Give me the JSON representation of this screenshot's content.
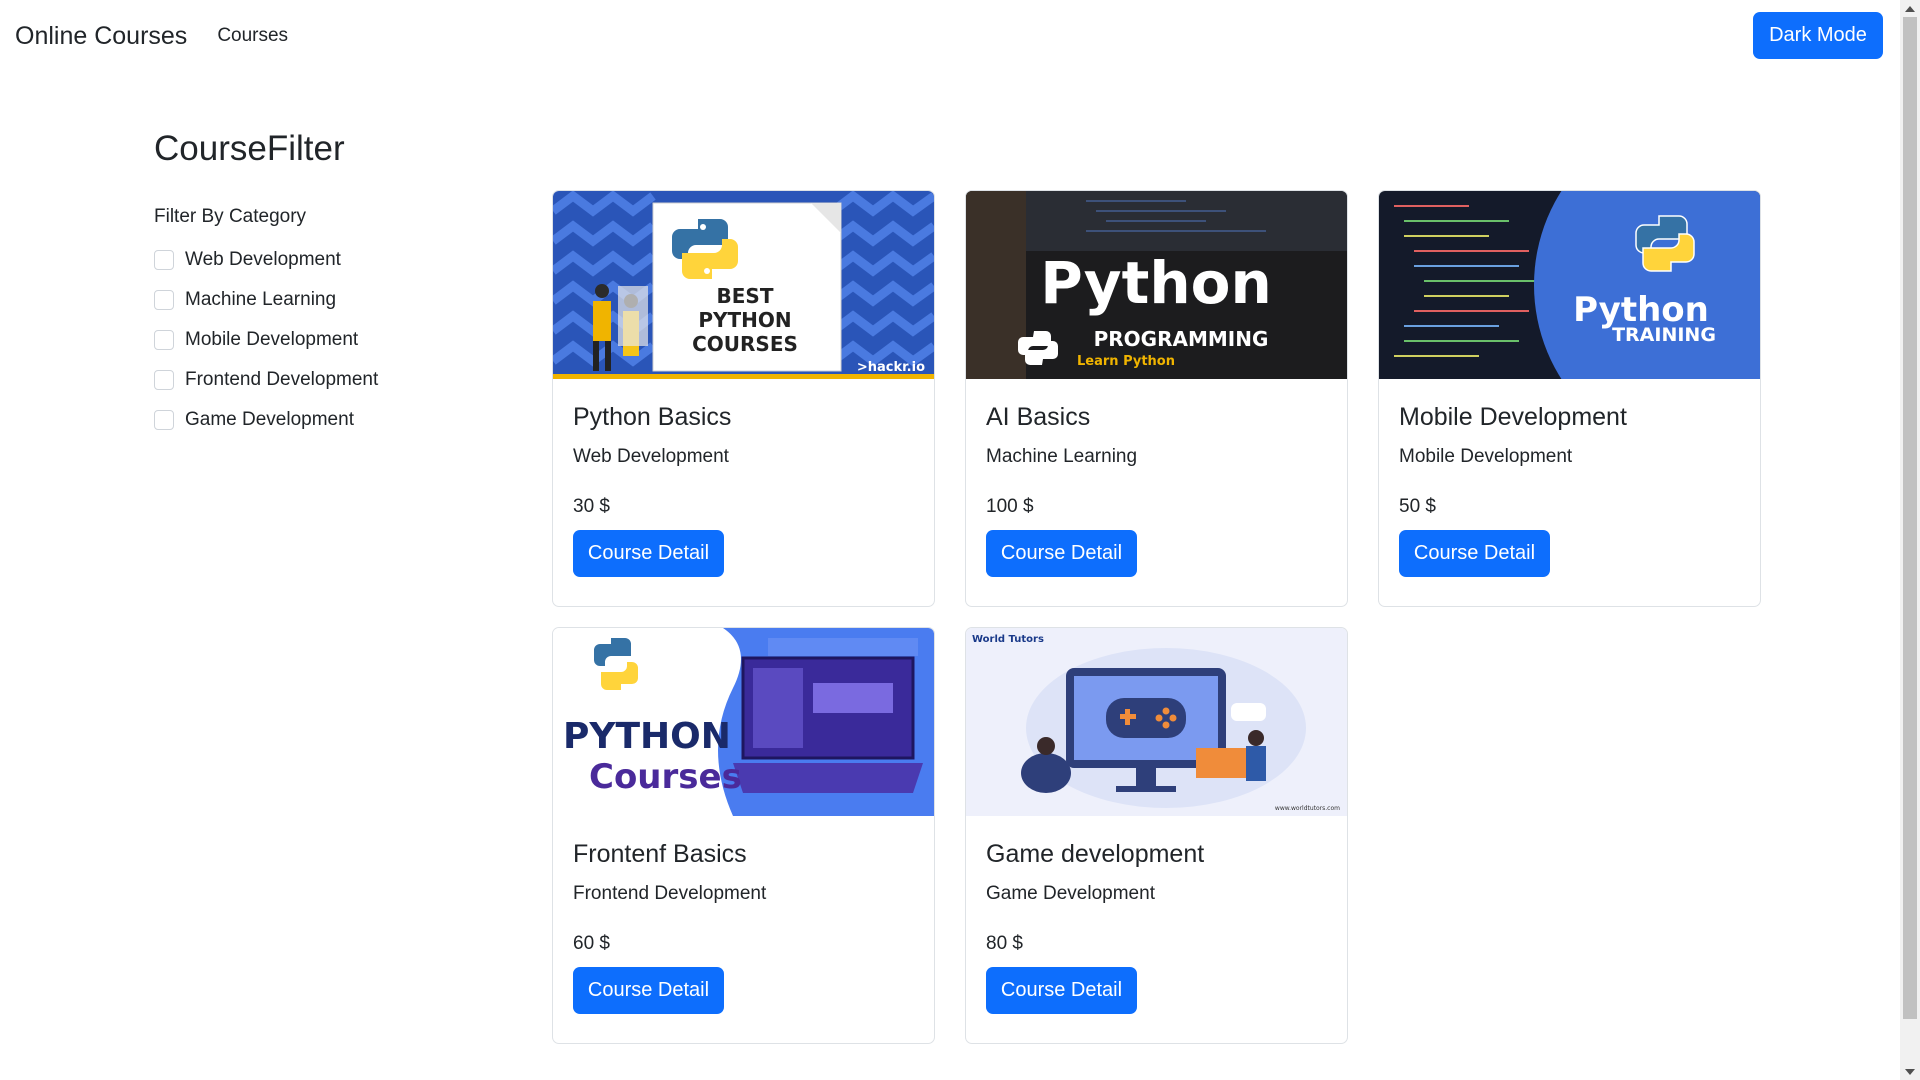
{
  "navbar": {
    "brand": "Online Courses",
    "courses_link": "Courses",
    "mode_button": "Dark Mode"
  },
  "filter": {
    "title": "CourseFilter",
    "label": "Filter By Category",
    "items": [
      {
        "label": "Web Development",
        "checked": false
      },
      {
        "label": "Machine Learning",
        "checked": false
      },
      {
        "label": "Mobile Development",
        "checked": false
      },
      {
        "label": "Frontend Development",
        "checked": false
      },
      {
        "label": "Game Development",
        "checked": false
      }
    ]
  },
  "courses": [
    {
      "title": "Python Basics",
      "category": "Web Development",
      "price": "30 $",
      "button": "Course Detail",
      "image": {
        "line1": "BEST",
        "line2": "PYTHON",
        "line3": "COURSES",
        "brand": ">hackr.io"
      }
    },
    {
      "title": "AI Basics",
      "category": "Machine Learning",
      "price": "100 $",
      "button": "Course Detail",
      "image": {
        "line1": "Python",
        "line2": "PROGRAMMING",
        "line3": "Learn Python"
      }
    },
    {
      "title": "Mobile Development",
      "category": "Mobile Development",
      "price": "50 $",
      "button": "Course Detail",
      "image": {
        "line1": "Python",
        "line2": "TRAINING"
      }
    },
    {
      "title": "Frontenf Basics",
      "category": "Frontend Development",
      "price": "60 $",
      "button": "Course Detail",
      "image": {
        "line1": "PYTHON",
        "line2": "Courses"
      }
    },
    {
      "title": "Game development",
      "category": "Game Development",
      "price": "80 $",
      "button": "Course Detail",
      "image": {
        "brand": "World Tutors",
        "url": "www.worldtutors.com"
      }
    }
  ],
  "colors": {
    "primary": "#0d6efd",
    "text": "#212529",
    "border": "#dee2e6",
    "python_blue": "#3572a5",
    "python_yellow": "#ffd43b"
  }
}
